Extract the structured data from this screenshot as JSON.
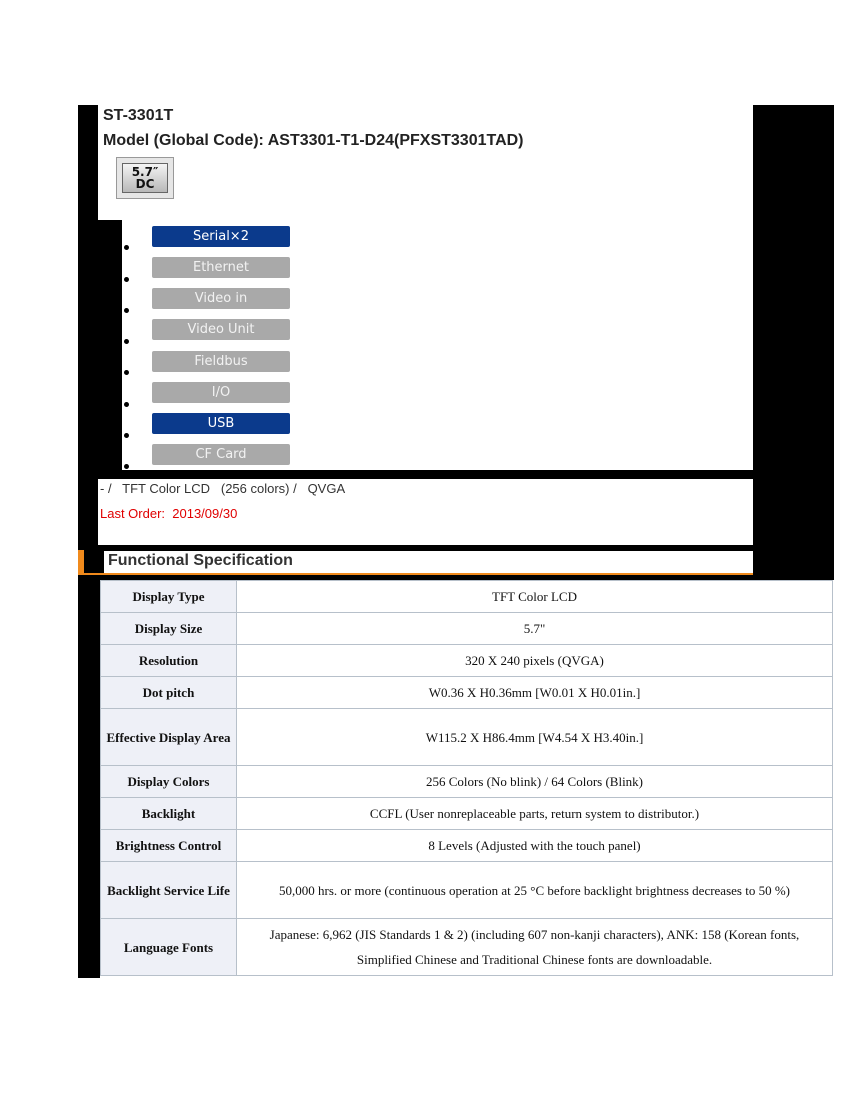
{
  "header": {
    "product": "ST-3301T",
    "model_line": "Model (Global Code): AST3301-T1-D24(PFXST3301TAD)",
    "badge": {
      "line1": "5.7″",
      "line2": "DC"
    }
  },
  "features": [
    {
      "label": "Serial×2",
      "active": true
    },
    {
      "label": "Ethernet",
      "active": false
    },
    {
      "label": "Video in",
      "active": false
    },
    {
      "label": "Video Unit",
      "active": false
    },
    {
      "label": "Fieldbus",
      "active": false
    },
    {
      "label": "I/O",
      "active": false
    },
    {
      "label": "USB",
      "active": true
    },
    {
      "label": "CF Card",
      "active": false
    }
  ],
  "summary": {
    "line": "- /   TFT Color LCD   (256 colors) /   QVGA",
    "last_order": "Last Order:  2013/09/30"
  },
  "section": {
    "title": "Functional Specification"
  },
  "specs": [
    {
      "key": "Display Type",
      "value": "TFT Color LCD"
    },
    {
      "key": "Display Size",
      "value": "5.7\""
    },
    {
      "key": "Resolution",
      "value": "320 X 240 pixels (QVGA)"
    },
    {
      "key": "Dot pitch",
      "value": "W0.36 X H0.36mm [W0.01 X H0.01in.]"
    },
    {
      "key": "Effective Display Area",
      "value": "W115.2 X H86.4mm [W4.54 X H3.40in.]"
    },
    {
      "key": "Display Colors",
      "value": "256 Colors (No blink) / 64 Colors (Blink)"
    },
    {
      "key": "Backlight",
      "value": "CCFL (User nonreplaceable parts, return system to distributor.)"
    },
    {
      "key": "Brightness Control",
      "value": "8 Levels (Adjusted with the touch panel)"
    },
    {
      "key": "Backlight Service Life",
      "value": "50,000 hrs. or more (continuous operation at 25 °C before backlight brightness decreases to 50 %)"
    },
    {
      "key": "Language Fonts",
      "value": "Japanese: 6,962 (JIS Standards 1 & 2) (including 607 non-kanji characters), ANK: 158 (Korean fonts, Simplified Chinese and Traditional Chinese fonts are downloadable."
    }
  ],
  "colors": {
    "accent_orange": "#f08a1c",
    "feature_active": "#0b3a8c",
    "feature_inactive": "#a9a9a9",
    "last_order": "#e00000"
  }
}
